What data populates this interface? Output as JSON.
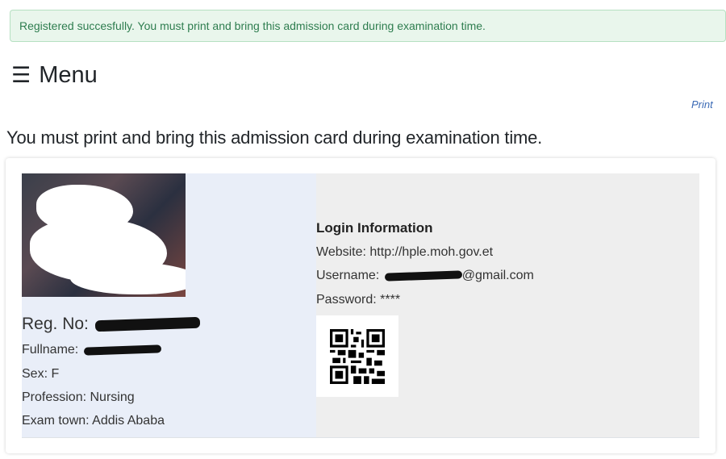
{
  "alert": {
    "text": "Registered succesfully. You must print and bring this admission card during examination time."
  },
  "menu": {
    "icon": "hamburger-icon",
    "label": "Menu",
    "glyph": "☰"
  },
  "print": {
    "label": "Print"
  },
  "notice": {
    "text": "You must print and bring this admission card during examination time."
  },
  "card": {
    "reg_label": "Reg. No: ",
    "fullname_label": "Fullname: ",
    "sex": "Sex: F",
    "profession": "Profession: Nursing",
    "exam_town": "Exam town: Addis Ababa",
    "login": {
      "title": "Login Information",
      "website": "Website: http://hple.moh.gov.et",
      "username_label": "Username: ",
      "username_suffix": "@gmail.com",
      "password": "Password: ****"
    }
  },
  "colors": {
    "alert_bg": "#e9f6ec",
    "alert_text": "#2e7d4f",
    "link": "#3b6ab5",
    "left_panel": "#e9eef8",
    "right_panel": "#eeeeee"
  }
}
